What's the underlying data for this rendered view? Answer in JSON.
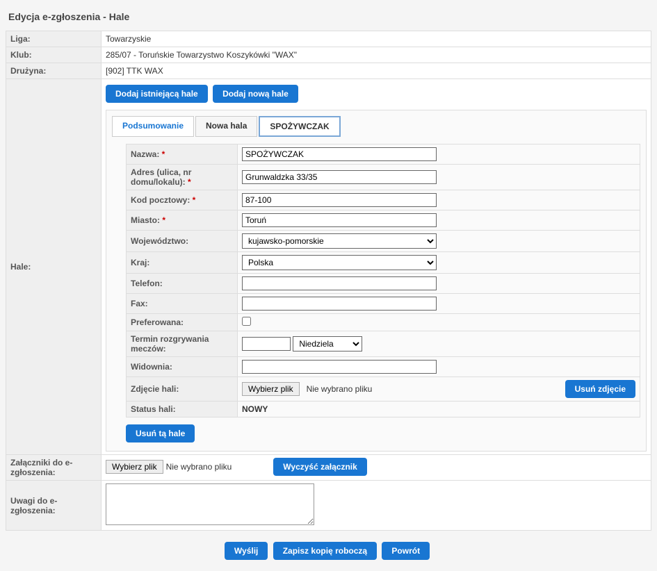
{
  "page_title": "Edycja e-zgłoszenia - Hale",
  "info": {
    "liga_label": "Liga:",
    "liga_value": "Towarzyskie",
    "klub_label": "Klub:",
    "klub_value": "285/07 - Toruńskie Towarzystwo Koszykówki \"WAX\"",
    "druzyna_label": "Drużyna:",
    "druzyna_value": "[902] TTK WAX"
  },
  "hale": {
    "section_label": "Hale:",
    "add_existing": "Dodaj istniejącą hale",
    "add_new": "Dodaj nową hale",
    "tabs": {
      "summary": "Podsumowanie",
      "new_hall": "Nowa hala",
      "spozywczak": "SPOŻYWCZAK"
    },
    "form": {
      "nazwa_label": "Nazwa:",
      "nazwa_value": "SPOŻYWCZAK",
      "adres_label": "Adres (ulica, nr domu/lokalu):",
      "adres_value": "Grunwaldzka 33/35",
      "kod_label": "Kod pocztowy:",
      "kod_value": "87-100",
      "miasto_label": "Miasto:",
      "miasto_value": "Toruń",
      "woj_label": "Województwo:",
      "woj_value": "kujawsko-pomorskie",
      "kraj_label": "Kraj:",
      "kraj_value": "Polska",
      "telefon_label": "Telefon:",
      "telefon_value": "",
      "fax_label": "Fax:",
      "fax_value": "",
      "pref_label": "Preferowana:",
      "termin_label": "Termin rozgrywania meczów:",
      "termin_day": "Niedziela",
      "widownia_label": "Widownia:",
      "widownia_value": "",
      "zdjecie_label": "Zdjęcie hali:",
      "file_choose": "Wybierz plik",
      "file_none": "Nie wybrano pliku",
      "remove_photo": "Usuń zdjęcie",
      "status_label": "Status hali:",
      "status_value": "NOWY",
      "remove_hall": "Usuń tą hale"
    }
  },
  "attachments": {
    "label": "Załączniki do e-zgłoszenia:",
    "file_choose": "Wybierz plik",
    "file_none": "Nie wybrano pliku",
    "clear": "Wyczyść załącznik"
  },
  "notes": {
    "label": "Uwagi do e-zgłoszenia:"
  },
  "actions": {
    "send": "Wyślij",
    "save_draft": "Zapisz kopię roboczą",
    "back": "Powrót"
  },
  "star": " *"
}
